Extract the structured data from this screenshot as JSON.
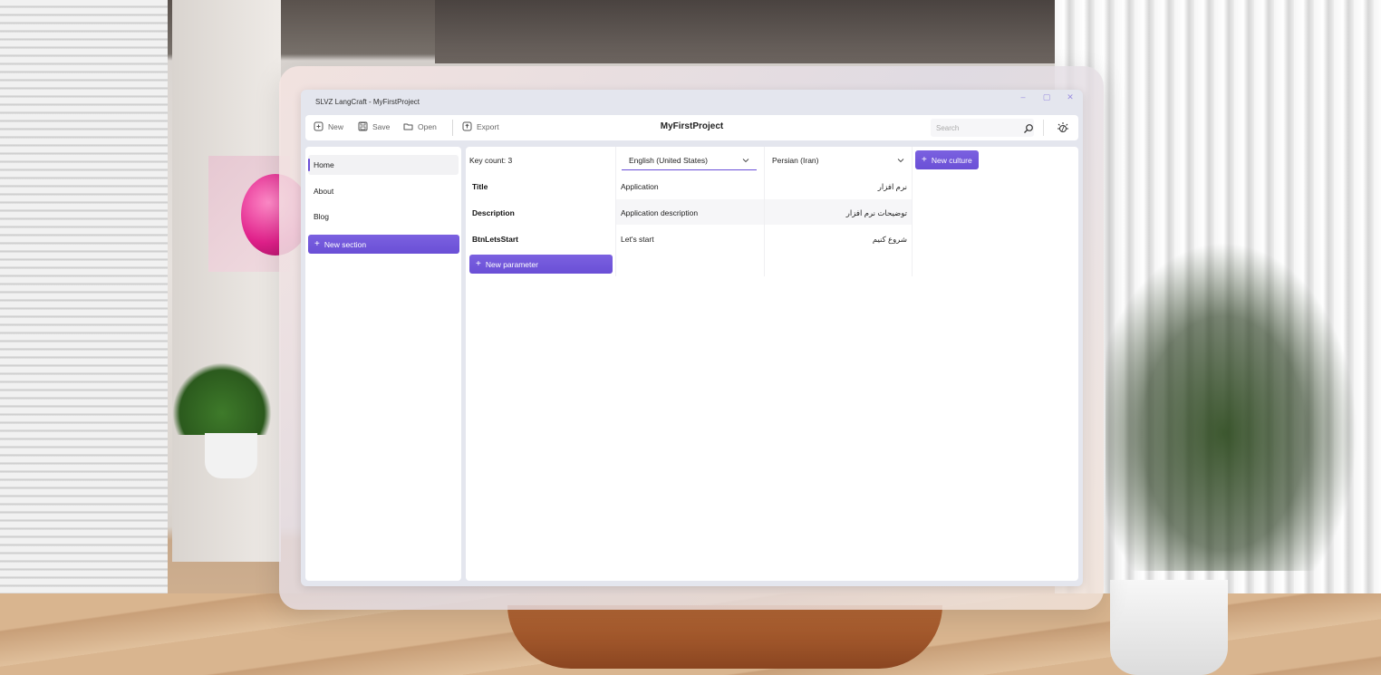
{
  "window": {
    "title": "SLVZ LangCraft - MyFirstProject",
    "controls": [
      "–",
      "▢",
      "✕"
    ]
  },
  "toolbar": {
    "new_label": "New",
    "save_label": "Save",
    "open_label": "Open",
    "export_label": "Export",
    "project_title": "MyFirstProject",
    "search_placeholder": "Search"
  },
  "sidebar": {
    "items": [
      {
        "label": "Home",
        "active": true
      },
      {
        "label": "About",
        "active": false
      },
      {
        "label": "Blog",
        "active": false
      }
    ],
    "new_section_label": "New section"
  },
  "main": {
    "key_count": "Key count: 3",
    "cultures": [
      {
        "name": "English (United States)",
        "selected": true
      },
      {
        "name": "Persian (Iran)",
        "selected": false
      }
    ],
    "new_culture_label": "New culture",
    "new_parameter_label": "New parameter",
    "rows": [
      {
        "key": "Title",
        "values": [
          "Application",
          "نرم افزار"
        ]
      },
      {
        "key": "Description",
        "values": [
          "Application description",
          "توضیحات نرم افزار"
        ]
      },
      {
        "key": "BtnLetsStart",
        "values": [
          "Let's start",
          "شروع کنیم"
        ]
      }
    ]
  },
  "colors": {
    "accent": "#6b4fd8",
    "window_bg": "#e4e6ee",
    "panel_bg": "#ffffff"
  },
  "icons": {
    "new": "file-plus-icon",
    "save": "floppy-disk-icon",
    "open": "folder-icon",
    "export": "export-icon",
    "search": "search-icon",
    "theme": "theme-toggle-icon",
    "dropdown": "chevron-down-icon"
  }
}
